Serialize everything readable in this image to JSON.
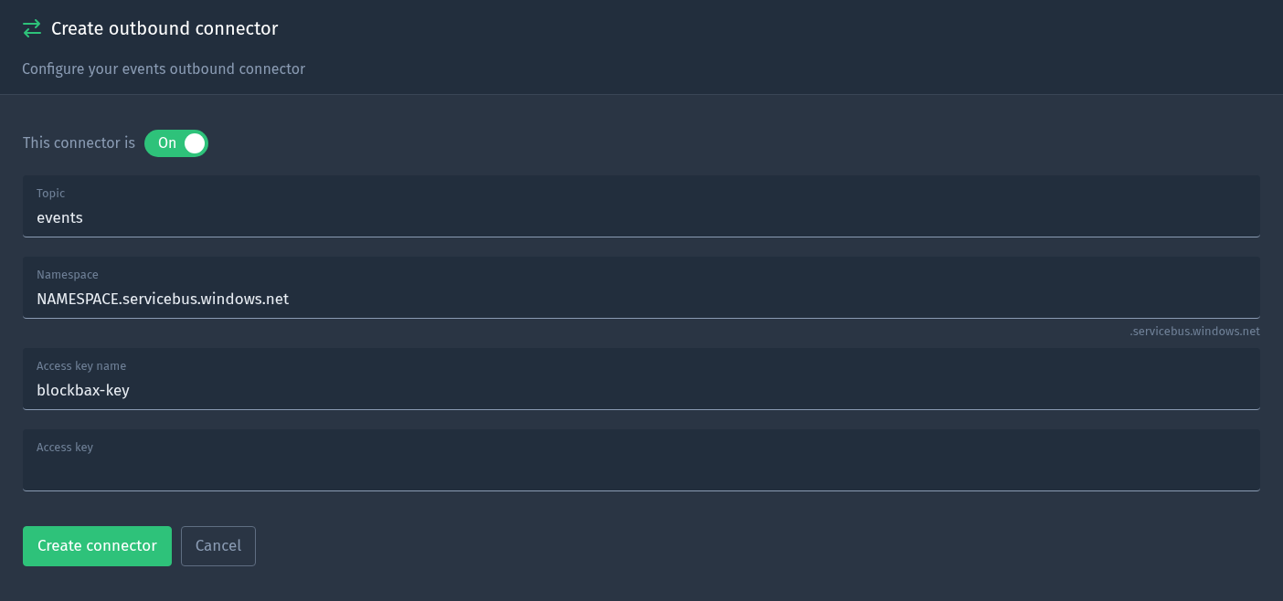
{
  "header": {
    "title": "Create outbound connector",
    "subtitle": "Configure your events outbound connector"
  },
  "status": {
    "label": "This connector is",
    "toggle": {
      "text": "On",
      "on": true
    }
  },
  "fields": [
    {
      "label": "Topic",
      "value": "events"
    },
    {
      "label": "Namespace",
      "value": "NAMESPACE.servicebus.windows.net",
      "hint": ".servicebus.windows.net"
    },
    {
      "label": "Access key name",
      "value": "blockbax-key"
    },
    {
      "label": "Access key"
    }
  ],
  "buttons": [
    {
      "label": "Create connector",
      "kind": "primary"
    },
    {
      "label": "Cancel",
      "kind": "secondary"
    }
  ]
}
